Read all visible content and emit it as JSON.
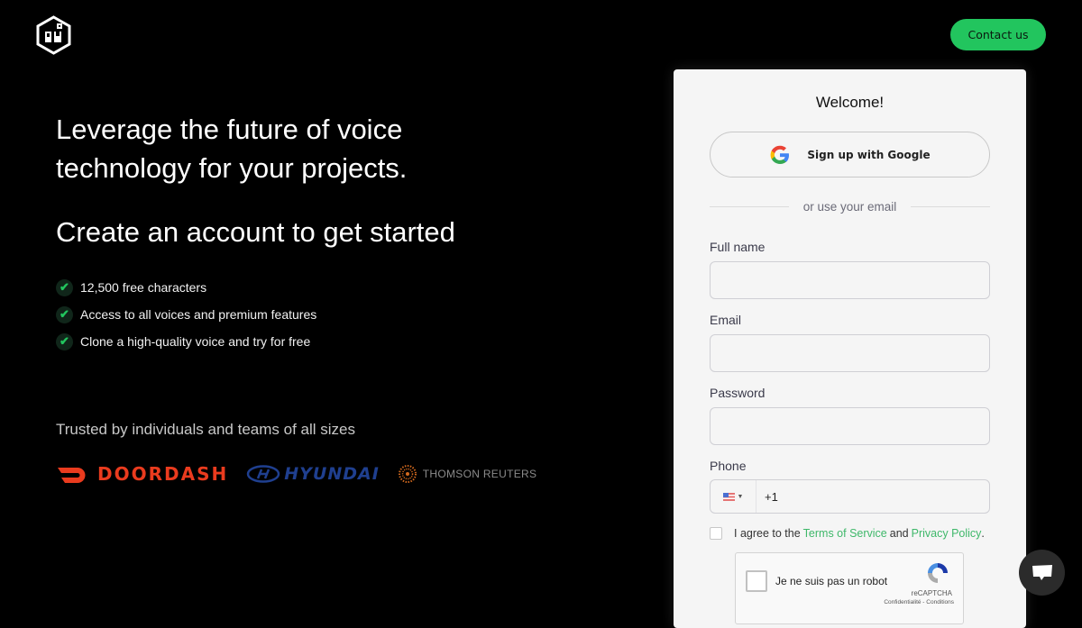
{
  "header": {
    "logo_alt": "PlayHT logo",
    "contact_label": "Contact us"
  },
  "hero": {
    "title": "Leverage the future of voice technology for your projects.",
    "subtitle": "Create an account to get started",
    "features": [
      "12,500 free characters",
      "Access to all voices and premium features",
      "Clone a high-quality voice and try for free"
    ],
    "trusted_text": "Trusted by individuals and teams of all sizes",
    "brands": [
      "DOORDASH",
      "HYUNDAI",
      "THOMSON REUTERS"
    ]
  },
  "form": {
    "welcome": "Welcome!",
    "google_label": "Sign up with Google",
    "divider_text": "or use your email",
    "full_name_label": "Full name",
    "full_name_value": "",
    "email_label": "Email",
    "email_value": "",
    "password_label": "Password",
    "password_value": "",
    "phone_label": "Phone",
    "phone_value": "+1",
    "phone_country": "US",
    "agree_prefix": "I agree to the",
    "terms_link": "Terms of Service",
    "agree_and": "and",
    "privacy_link": "Privacy Policy",
    "agree_suffix": ".",
    "recaptcha_label": "Je ne suis pas un robot",
    "recaptcha_brand": "reCAPTCHA",
    "recaptcha_links": "Confidentialité - Conditions"
  },
  "colors": {
    "accent": "#22c55e",
    "link": "#3fb86a",
    "background": "#000000",
    "card": "#f5f5f5"
  }
}
